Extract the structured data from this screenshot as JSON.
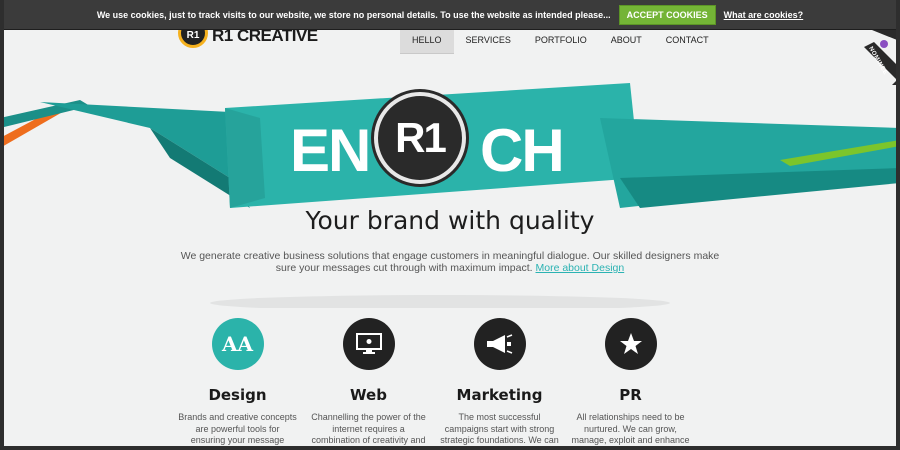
{
  "cookie_bar": {
    "message": "We use cookies, just to track visits to our website, we store no personal details. To use the website as intended please...",
    "accept_label": "ACCEPT COOKIES",
    "info_link": "What are cookies?"
  },
  "header": {
    "logo_mark": "R1",
    "logo_text": "R1 CREATIVE",
    "nav": [
      {
        "label": "HELLO",
        "active": true
      },
      {
        "label": "SERVICES",
        "active": false
      },
      {
        "label": "PORTFOLIO",
        "active": false
      },
      {
        "label": "ABOUT",
        "active": false
      },
      {
        "label": "CONTACT",
        "active": false
      }
    ]
  },
  "hero": {
    "word_left": "EN",
    "badge": "R1",
    "word_right": "CH",
    "tagline": "Your brand with quality",
    "intro": "We generate creative business solutions that engage customers in meaningful dialogue. Our skilled designers make sure your messages cut through with maximum impact.",
    "intro_link": "More about Design"
  },
  "services": [
    {
      "icon": "typography-icon",
      "icon_text": "AA",
      "title": "Design",
      "desc": "Brands and creative concepts are powerful tools for ensuring your message stands out and engages with consumers. We"
    },
    {
      "icon": "monitor-icon",
      "title": "Web",
      "desc": "Channelling the power of the internet requires a combination of creativity and scientific method. Web skilled"
    },
    {
      "icon": "megaphone-icon",
      "title": "Marketing",
      "desc": "The most successful campaigns start with strong strategic foundations. We can provide a powerful mix of"
    },
    {
      "icon": "star-icon",
      "title": "PR",
      "desc": "All relationships need to be nurtured. We can grow, manage, exploit and enhance your connections to individuals"
    }
  ],
  "nominee_badge": {
    "text": "NOMINEE",
    "brand": "CSSDA"
  },
  "colors": {
    "teal": "#2bb3aa",
    "accept_green": "#74b436",
    "dark": "#222222",
    "orange": "#ee6d1d",
    "lime": "#7cc52b"
  }
}
